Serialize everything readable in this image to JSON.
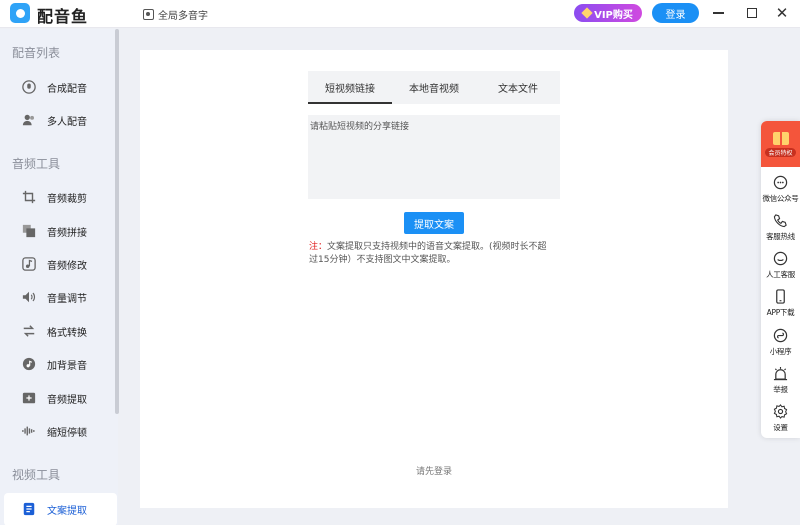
{
  "titlebar": {
    "app_name": "配音鱼",
    "global_dub": "全局多音字",
    "vip_label": "VIP购买",
    "login_label": "登录"
  },
  "sidebar": {
    "section_dub": "配音列表",
    "section_audio": "音频工具",
    "section_video": "视频工具",
    "dub_items": [
      {
        "label": "合成配音",
        "icon": "mic-icon"
      },
      {
        "label": "多人配音",
        "icon": "users-icon"
      }
    ],
    "audio_items": [
      {
        "label": "音频裁剪",
        "icon": "crop-icon"
      },
      {
        "label": "音频拼接",
        "icon": "copy-icon"
      },
      {
        "label": "音频修改",
        "icon": "music-icon"
      },
      {
        "label": "音量调节",
        "icon": "volume-icon"
      },
      {
        "label": "格式转换",
        "icon": "convert-icon"
      },
      {
        "label": "加背景音",
        "icon": "music-add-icon"
      },
      {
        "label": "音频提取",
        "icon": "extract-icon"
      },
      {
        "label": "缩短停顿",
        "icon": "waveform-icon"
      }
    ],
    "video_items": [
      {
        "label": "文案提取",
        "icon": "document-icon",
        "active": true
      }
    ]
  },
  "main": {
    "tabs": [
      {
        "label": "短视频链接",
        "active": true
      },
      {
        "label": "本地音视频",
        "active": false
      },
      {
        "label": "文本文件",
        "active": false
      }
    ],
    "input_placeholder": "请粘贴短视频的分享链接",
    "extract_button": "提取文案",
    "note_prefix": "注：",
    "note_text": "文案提取只支持视频中的语音文案提取。(视频时长不超过15分钟）不支持图文中文案提取。",
    "login_hint": "请先登录"
  },
  "float_bar": {
    "promo_text": "会员特权",
    "items": [
      {
        "label": "微信公众号",
        "icon": "wechat-icon"
      },
      {
        "label": "客服热线",
        "icon": "phone-icon"
      },
      {
        "label": "人工客服",
        "icon": "support-icon"
      },
      {
        "label": "APP下载",
        "icon": "mobile-icon"
      },
      {
        "label": "小程序",
        "icon": "miniprogram-icon"
      },
      {
        "label": "举报",
        "icon": "report-icon"
      },
      {
        "label": "设置",
        "icon": "settings-icon"
      }
    ]
  },
  "colors": {
    "accent": "#1b90f5",
    "sidebar_bg": "#eef1f8",
    "note_red": "#e02020",
    "promo_red": "#f4553b"
  }
}
